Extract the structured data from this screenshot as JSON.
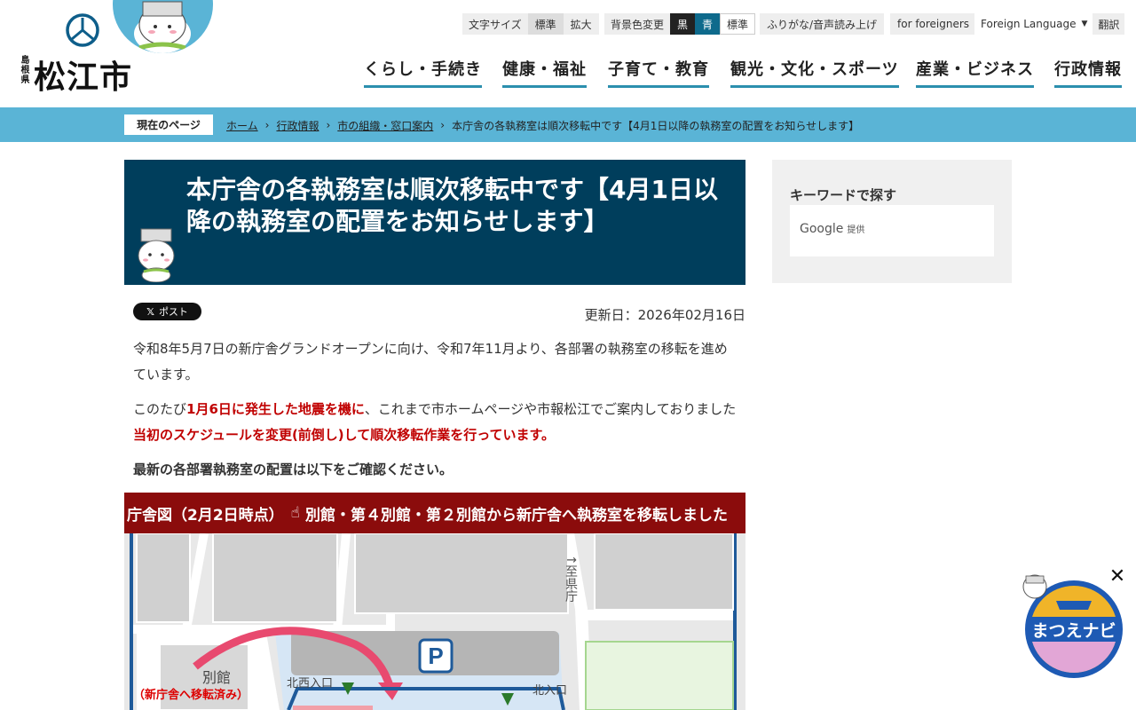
{
  "header": {
    "logo_pref": "島根県",
    "logo_city": "松江市",
    "font_size_label": "文字サイズ",
    "font_size_options": [
      "標準",
      "拡大"
    ],
    "bg_label": "背景色変更",
    "bg_options": [
      "黒",
      "青",
      "標準"
    ],
    "furigana": "ふりがな/音声読み上げ",
    "foreigners": "for foreigners",
    "foreign_language": "Foreign Language",
    "translate": "翻訳"
  },
  "nav": {
    "items": [
      "くらし・手続き",
      "健康・福祉",
      "子育て・教育",
      "観光・文化・スポーツ",
      "産業・ビジネス",
      "行政情報"
    ]
  },
  "breadcrumb": {
    "label": "現在のページ",
    "items": [
      "ホーム",
      "行政情報",
      "市の組織・窓口案内"
    ],
    "current": "本庁舎の各執務室は順次移転中です【4月1日以降の執務室の配置をお知らせします】"
  },
  "article": {
    "title": "本庁舎の各執務室は順次移転中です【4月1日以降の執務室の配置をお知らせします】",
    "post_label": "ポスト",
    "updated": "更新日：2026年02月16日",
    "p1": "令和8年5月7日の新庁舎グランドオープンに向け、令和7年11月より、各部署の執務室の移転を進めています。",
    "p2_a": "このたび",
    "p2_b": "1月6日に発生した地震を機に",
    "p2_c": "、これまで市ホームページや市報松江でご案内しておりました",
    "p2_d": "当初のスケジュールを変更(前倒し)して順次移転作業を行っています。",
    "p3": "最新の各部署執務室の配置は以下をご確認ください。"
  },
  "map": {
    "header": "庁舎図（2月2日時点）",
    "header_note": "別館・第４別館・第２別館から新庁舎へ執務室を移転しました",
    "to_pref_office": "↑至県庁",
    "annex": "別館",
    "annex_moved": "（新庁舎へ移転済み）",
    "nw_entrance": "北西入口",
    "n_entrance": "北入口",
    "parking": "P"
  },
  "sidebar": {
    "title": "キーワードで探す",
    "google": "Google",
    "provided": "提供"
  },
  "navi": {
    "label": "まつえナビ",
    "close": "✕"
  },
  "colors": {
    "accent": "#5ab4d6",
    "title_bg": "#003e5c",
    "map_header": "#8b0c0c",
    "emphasis": "#c00000"
  }
}
